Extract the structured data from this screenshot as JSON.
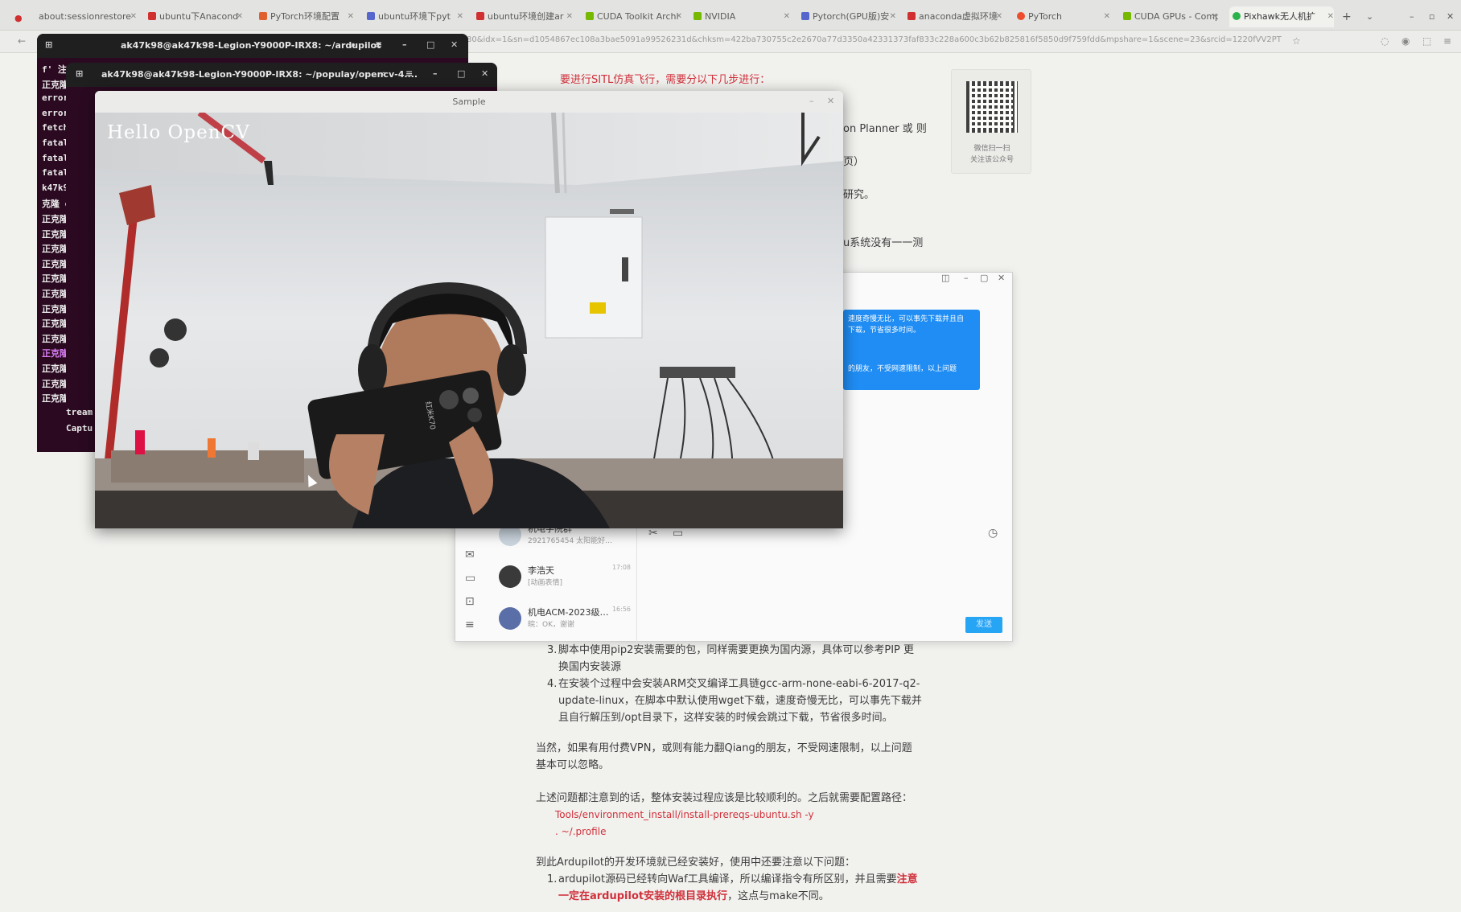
{
  "browser": {
    "tabs": [
      {
        "label": "about:sessionrestore",
        "color": "#e8574a"
      },
      {
        "label": "ubuntu下Anacond",
        "color": "#d03030"
      },
      {
        "label": "PyTorch环境配置",
        "color": "#e06030"
      },
      {
        "label": "ubuntu环境下pyt",
        "color": "#5566cc"
      },
      {
        "label": "ubuntu环境创建ar",
        "color": "#d03030"
      },
      {
        "label": "CUDA Toolkit Archi",
        "color": "#76b900"
      },
      {
        "label": "NVIDIA",
        "color": "#76b900"
      },
      {
        "label": "Pytorch(GPU版)安",
        "color": "#5566cc"
      },
      {
        "label": "anaconda虚拟环境",
        "color": "#d03030"
      },
      {
        "label": "PyTorch",
        "color": "#ee4c2c"
      },
      {
        "label": "CUDA GPUs - Comp",
        "color": "#76b900"
      },
      {
        "label": "Pixhawk无人机扩",
        "color": "#2bb24c"
      }
    ],
    "url": "80&idx=1&sn=d1054867ec108a3bae5091a99526231d&chksm=422ba730755c2e2670a77d3350a42331373faf833c228a600c3b62b825816f5850d9f759fdd&mpshare=1&scene=23&srcid=1220fVV2PT"
  },
  "article": {
    "intro": "要进行SITL仿真飞行，需要分以下几步进行：",
    "frag_planner": "on    Planner  或  则",
    "frag_page": "页）",
    "frag_research": "研究。",
    "frag_ubuntu": "u系统没有一一测",
    "item3_num": "3.",
    "item3_line1": "脚本中使用pip2安装需要的包，同样需要更换为国内源，具体可以参考PIP 更",
    "item3_line2": "换国内安装源",
    "item4_num": "4.",
    "item4_line1": "在安装个过程中会安装ARM交叉编译工具链gcc-arm-none-eabi-6-2017-q2-",
    "item4_line2": "update-linux，在脚本中默认使用wget下载，速度奇慢无比，可以事先下载并",
    "item4_line3": "且自行解压到/opt目录下，这样安装的时候会跳过下载，节省很多时间。",
    "para1_line1": "当然，如果有用付费VPN，或则有能力翻Qiang的朋友，不受网速限制，以上问题",
    "para1_line2": "基本可以忽略。",
    "para2": "上述问题都注意到的话，整体安装过程应该是比较顺利的。之后就需要配置路径：",
    "code1": "Tools/environment_install/install-prereqs-ubuntu.sh -y",
    "code2": ". ~/.profile",
    "para3": "到此Ardupilot的开发环境就已经安装好，使用中还要注意以下问题：",
    "item1_num": "1.",
    "item1_line1a": "ardupilot源码已经转向Waf工具编译，所以编译指令有所区别，并且需要",
    "item1_line1b": "注意",
    "item1_line2a": "一定在ardupilot安装的根目录执行",
    "item1_line2b": "，这点与make不同。"
  },
  "qr": {
    "line1": "微信扫一扫",
    "line2": "关注该公众号"
  },
  "terminal1": {
    "title": "ak47k98@ak47k98-Legion-Y9000P-IRX8: ~/ardupilot",
    "lines": [
      "f' 注",
      "正克隆",
      "error --",
      "error --",
      "fetch _flann",
      "fatal :opencv",
      "fatal v_aruc",
      "fatal asets",
      "k47k9:etype",
      "克隆 orn;o",
      "正克隆ncv_p",
      "正克隆cv_sh",
      "正克隆tching",
      "正克隆ode;op",
      "正克隆--",
      "正克隆-- Co",
      "正克隆-- Ge",
      "正克隆-- Bu",
      "正克隆cpp/e",
      "正克隆Conso",
      "正克隆[100%",
      "正克隆Built",
      "正克隆[ WAR"
    ]
  },
  "terminal2": {
    "title": "ak47k98@ak47k98-Legion-Y9000P-IRX8: ~/populay/opencv-4....",
    "lines": [
      "tream",
      "Captu"
    ]
  },
  "opencv_window": {
    "title": "Sample",
    "overlay_text": "Hello OpenCV",
    "phone_text": "红米K70"
  },
  "chat": {
    "bubble_line1": "速度奇慢无比，可以事先下载并且自",
    "bubble_line2": "下载，节省很多时间。",
    "bubble_line3": "的朋友，不受网速限制，以上问题",
    "contacts": [
      {
        "name": "机电学院群",
        "sub": "2921765454  太阳能好…",
        "time": ""
      },
      {
        "name": "李浩天",
        "sub": "[动画表情]",
        "time": "17:08"
      },
      {
        "name": "机电ACM-2023级…",
        "sub": "皖：OK，谢谢",
        "time": "16:56"
      }
    ],
    "send_label": "发送"
  }
}
